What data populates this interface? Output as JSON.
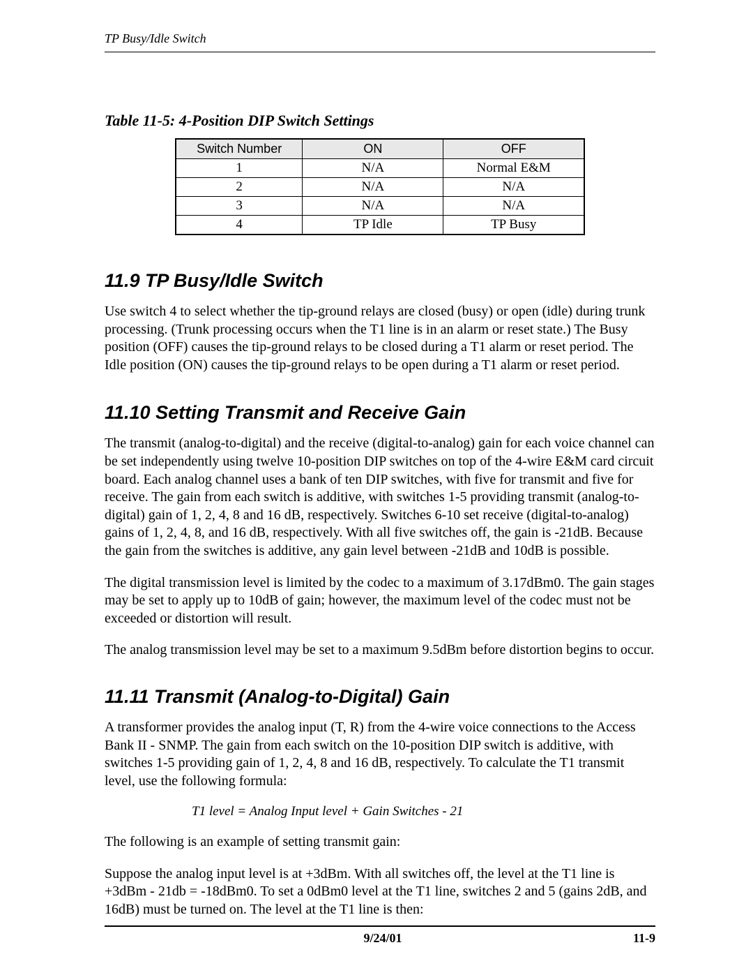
{
  "header": {
    "running_title": "TP Busy/Idle Switch"
  },
  "table": {
    "caption": "Table 11-5: 4-Position DIP Switch Settings",
    "headers": [
      "Switch Number",
      "ON",
      "OFF"
    ],
    "rows": [
      {
        "num": "1",
        "on": "N/A",
        "off": "Normal E&M"
      },
      {
        "num": "2",
        "on": "N/A",
        "off": "N/A"
      },
      {
        "num": "3",
        "on": "N/A",
        "off": "N/A"
      },
      {
        "num": "4",
        "on": "TP Idle",
        "off": "TP Busy"
      }
    ]
  },
  "sections": {
    "s1": {
      "heading": "11.9  TP Busy/Idle Switch",
      "p1": "Use switch 4 to select whether the tip-ground relays are closed (busy) or open (idle) during trunk processing. (Trunk processing occurs when the T1 line is in an alarm or reset state.) The Busy position (OFF) causes the tip-ground relays to be closed during a T1 alarm or reset period. The Idle position (ON) causes the tip-ground relays to be open during a T1 alarm or reset period."
    },
    "s2": {
      "heading": "11.10  Setting Transmit and Receive Gain",
      "p1": "The transmit (analog-to-digital) and the receive (digital-to-analog) gain for each voice channel can be set independently using twelve 10-position DIP switches on top of the 4-wire E&M card circuit board. Each analog channel uses a bank of ten DIP switches, with five for transmit and five for receive. The gain from each switch is additive, with switches 1-5 providing transmit (analog-to-digital) gain of 1, 2, 4, 8 and 16 dB, respectively. Switches 6-10 set receive (digital-to-analog) gains of 1, 2, 4, 8, and 16 dB, respectively. With all five switches off, the gain is -21dB. Because the gain from the switches is additive, any gain level between -21dB and 10dB is possible.",
      "p2": "The digital transmission level is limited by the codec to a maximum of 3.17dBm0. The gain stages may be set to apply up to 10dB of gain; however, the maximum level of the codec must not be exceeded or distortion will result.",
      "p3": "The analog transmission level may be set to a maximum 9.5dBm before distortion begins to occur."
    },
    "s3": {
      "heading": "11.11  Transmit (Analog-to-Digital) Gain",
      "p1": "A transformer provides the analog input (T, R) from the 4-wire voice connections to the Access Bank II - SNMP. The gain from each switch on the 10-position DIP switch is additive, with switches 1-5 providing gain of 1, 2, 4, 8 and 16 dB, respectively. To calculate the T1 transmit level, use the following formula:",
      "formula": "T1 level = Analog Input level +  Gain Switches - 21",
      "p2": "The following is an example of setting transmit gain:",
      "p3": "Suppose the analog input level is at +3dBm. With all switches off, the level at the T1 line is +3dBm - 21db = -18dBm0. To set a 0dBm0 level at the T1 line, switches 2 and 5 (gains 2dB, and 16dB) must be turned on. The level at the T1 line is then:"
    }
  },
  "footer": {
    "date": "9/24/01",
    "page": "11-9"
  }
}
